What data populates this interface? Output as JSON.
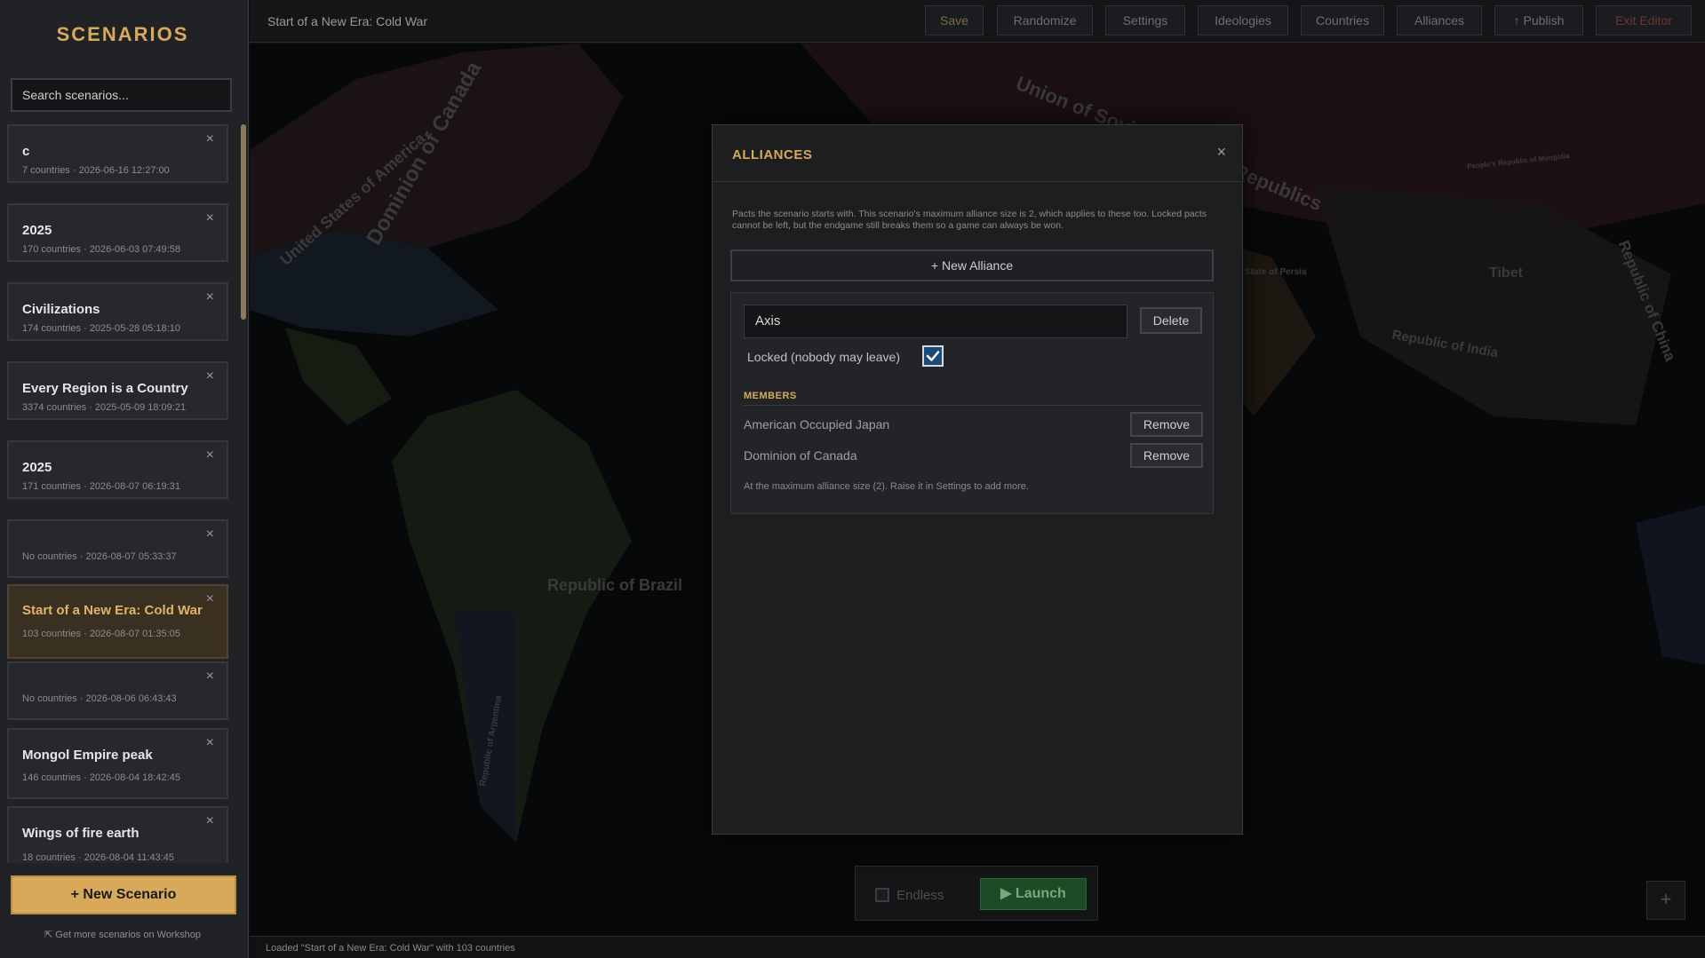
{
  "sidebar": {
    "title": "SCENARIOS",
    "search_placeholder": "Search scenarios...",
    "items": [
      {
        "name": "c",
        "meta": "7 countries · 2026-06-16 12:27:00"
      },
      {
        "name": "2025",
        "meta": "170 countries · 2026-06-03 07:49:58"
      },
      {
        "name": "Civilizations",
        "meta": "174 countries · 2025-05-28 05:18:10"
      },
      {
        "name": "Every Region is a Country",
        "meta": "3374 countries · 2025-05-09 18:09:21"
      },
      {
        "name": "2025",
        "meta": "171 countries · 2026-08-07 06:19:31"
      },
      {
        "name": "",
        "meta": "No countries · 2026-08-07 05:33:37"
      },
      {
        "name": "Start of a New Era: Cold War",
        "meta": "103 countries · 2026-08-07 01:35:05"
      },
      {
        "name": "",
        "meta": "No countries · 2026-08-06 06:43:43"
      },
      {
        "name": "Mongol Empire peak",
        "meta": "146 countries · 2026-08-04 18:42:45"
      },
      {
        "name": "Wings of fire earth",
        "meta": "18 countries · 2026-08-04 11:43:45"
      }
    ],
    "close_glyph": "×",
    "new_scenario_label": "+ New Scenario",
    "workshop_link": "⇱ Get more scenarios on Workshop"
  },
  "topbar": {
    "doc_title": "Start of a New Era: Cold War",
    "buttons": {
      "save": "Save",
      "randomize": "Randomize",
      "settings": "Settings",
      "ideologies": "Ideologies",
      "countries": "Countries",
      "alliances": "Alliances",
      "publish": "↑ Publish",
      "exit": "Exit Editor"
    }
  },
  "map": {
    "labels": {
      "canada": "Dominion of Canada",
      "usa": "United States of America",
      "ussr": "Union of Soviet Socialist Republics",
      "brazil": "Republic of Brazil",
      "india": "Republic of India",
      "china": "Republic of China",
      "tibet": "Tibet",
      "persia": "State of Persia",
      "argentina": "Republic of Argentina",
      "mongolia": "People's Republic of Mongolia"
    }
  },
  "launch": {
    "endless_label": "Endless",
    "launch_label": "▶  Launch",
    "corner_glyph": "+"
  },
  "status": {
    "text": "Loaded \"Start of a New Era: Cold War\" with 103 countries"
  },
  "modal": {
    "title": "ALLIANCES",
    "close_glyph": "×",
    "description": "Pacts the scenario starts with. This scenario's maximum alliance size is 2, which applies to these too. Locked pacts cannot be left, but the endgame still breaks them so a game can always be won.",
    "new_alliance_label": "+ New Alliance",
    "alliance": {
      "name": "Axis",
      "delete_label": "Delete",
      "locked_label": "Locked (nobody may leave)",
      "locked": true,
      "members_title": "MEMBERS",
      "members": [
        {
          "name": "American Occupied Japan",
          "remove_label": "Remove"
        },
        {
          "name": "Dominion of Canada",
          "remove_label": "Remove"
        }
      ],
      "max_note": "At the maximum alliance size (2). Raise it in Settings to add more."
    }
  },
  "colors": {
    "accent": "#d8a95a",
    "launch_green": "#1f4a26",
    "exit_red": "#7a2e2e"
  }
}
